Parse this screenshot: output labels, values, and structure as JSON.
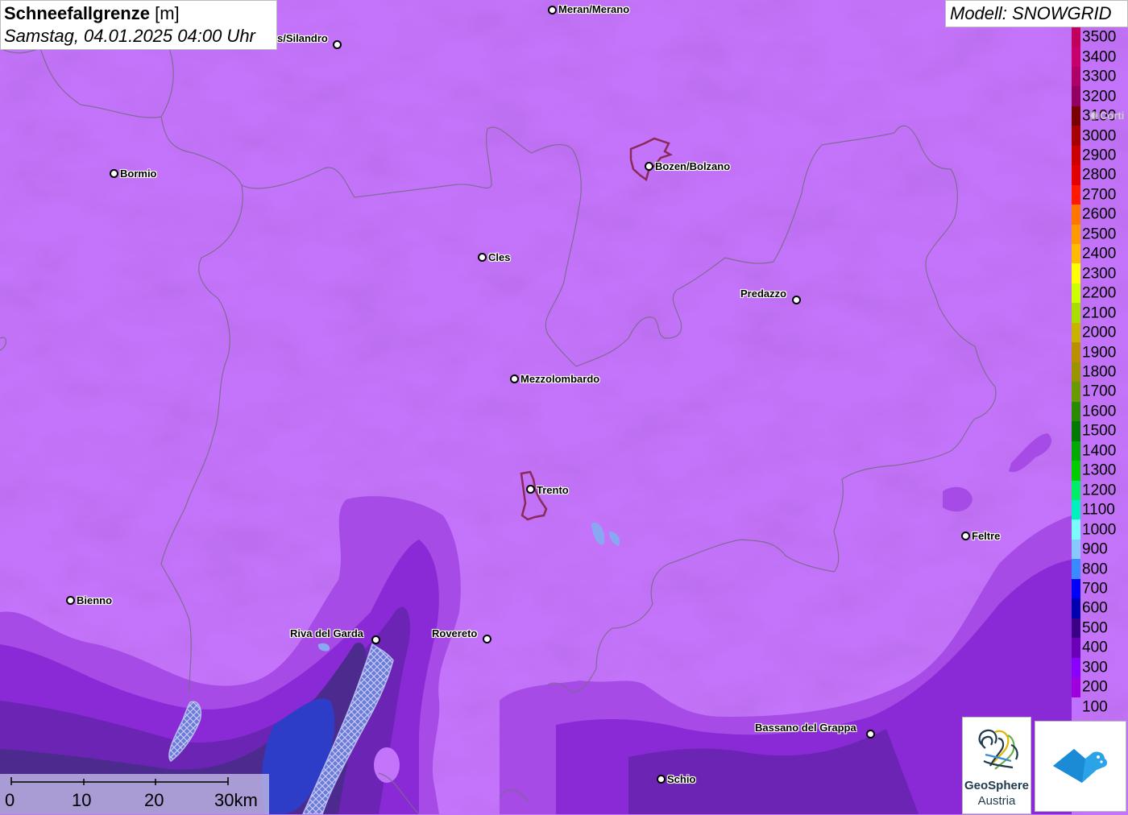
{
  "title": {
    "parameter": "Schneefallgrenze",
    "unit": "[m]",
    "datetime": "Samstag, 04.01.2025 04:00 Uhr"
  },
  "model": "Modell: SNOWGRID",
  "legend": [
    {
      "label": "3500",
      "color": "#c0005a"
    },
    {
      "label": "3400",
      "color": "#c8006c"
    },
    {
      "label": "3300",
      "color": "#b00068"
    },
    {
      "label": "3200",
      "color": "#940060"
    },
    {
      "label": "3100",
      "color": "#7a0000"
    },
    {
      "label": "3000",
      "color": "#a80000"
    },
    {
      "label": "2900",
      "color": "#cc0000"
    },
    {
      "label": "2800",
      "color": "#e20000"
    },
    {
      "label": "2700",
      "color": "#ff1a00"
    },
    {
      "label": "2600",
      "color": "#ff7700"
    },
    {
      "label": "2500",
      "color": "#ff9a00"
    },
    {
      "label": "2400",
      "color": "#ffbb00"
    },
    {
      "label": "2300",
      "color": "#ffff00"
    },
    {
      "label": "2200",
      "color": "#ccff00"
    },
    {
      "label": "2100",
      "color": "#aadd00"
    },
    {
      "label": "2000",
      "color": "#c8b400"
    },
    {
      "label": "1900",
      "color": "#b89000"
    },
    {
      "label": "1800",
      "color": "#9a9400"
    },
    {
      "label": "1700",
      "color": "#6a9a00"
    },
    {
      "label": "1600",
      "color": "#2a8a00"
    },
    {
      "label": "1500",
      "color": "#007a00"
    },
    {
      "label": "1400",
      "color": "#00aa00"
    },
    {
      "label": "1300",
      "color": "#00cc00"
    },
    {
      "label": "1200",
      "color": "#00ee66"
    },
    {
      "label": "1100",
      "color": "#00f0c0"
    },
    {
      "label": "1000",
      "color": "#7afcff"
    },
    {
      "label": "900",
      "color": "#88c8ff"
    },
    {
      "label": "800",
      "color": "#3a8aff"
    },
    {
      "label": "700",
      "color": "#0000ff"
    },
    {
      "label": "600",
      "color": "#0000b0"
    },
    {
      "label": "500",
      "color": "#3a0088"
    },
    {
      "label": "400",
      "color": "#6a00b8"
    },
    {
      "label": "300",
      "color": "#8a00ff"
    },
    {
      "label": "200",
      "color": "#a000e0"
    },
    {
      "label": "100",
      "color": "#c070ff"
    }
  ],
  "cities": [
    {
      "name": "Meran/Merano"
    },
    {
      "name": "s/Silandro"
    },
    {
      "name": "Bormio"
    },
    {
      "name": "Bozen/Bolzano"
    },
    {
      "name": "Cles"
    },
    {
      "name": "Predazzo"
    },
    {
      "name": "Mezzolombardo"
    },
    {
      "name": "Trento"
    },
    {
      "name": "Feltre"
    },
    {
      "name": "Bienno"
    },
    {
      "name": "Riva del Garda"
    },
    {
      "name": "Rovereto"
    },
    {
      "name": "Bassano del Grappa"
    },
    {
      "name": "Schio"
    },
    {
      "name": "Corti"
    }
  ],
  "scalebar": {
    "labels": [
      "0",
      "10",
      "20",
      "30km"
    ]
  },
  "logos": {
    "geosphere_name": "GeoSphere",
    "geosphere_country": "Austria"
  },
  "colors": {
    "snowline_100": "#c474fa",
    "snowline_200": "#a64be6",
    "snowline_300": "#8a2ad6",
    "snowline_400": "#6c24b4",
    "snowline_500": "#4c2a8e",
    "snowline_700": "#2e3dc8",
    "lake": "#7f9fe6",
    "border": "#7a6a8a",
    "urban": "#8a2a58"
  }
}
